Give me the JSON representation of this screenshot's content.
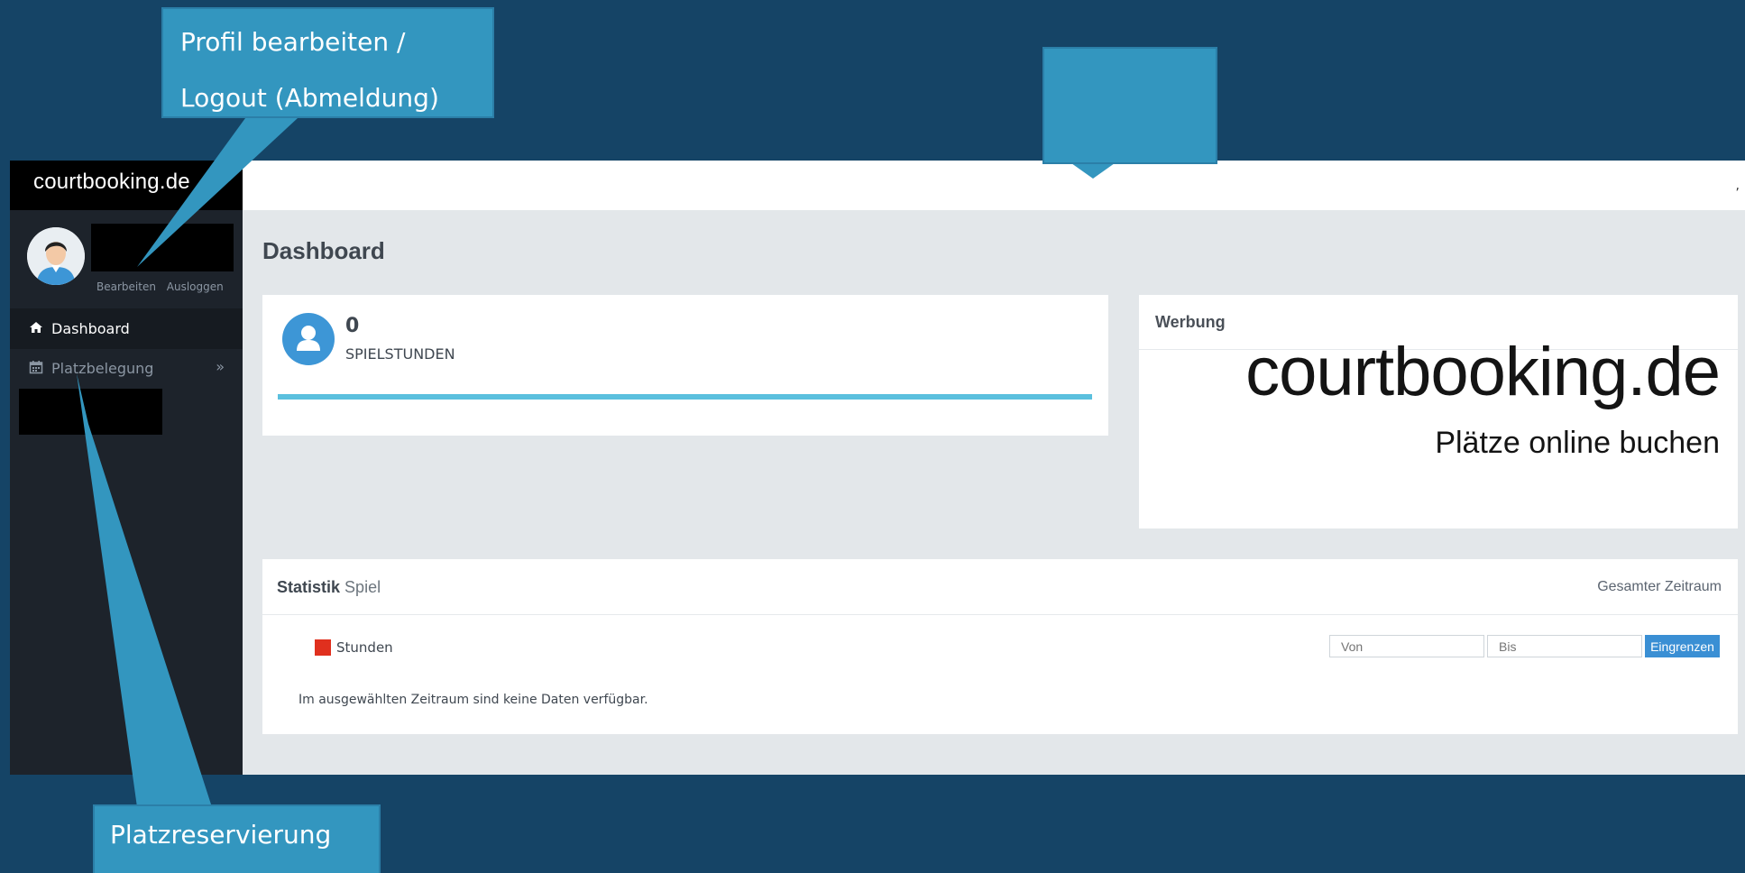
{
  "app": {
    "brand": "courtbooking.de",
    "profile_links": {
      "edit": "Bearbeiten",
      "logout": "Ausloggen"
    }
  },
  "sidebar": {
    "items": [
      {
        "label": "Dashboard",
        "icon": "home-icon",
        "active": true
      },
      {
        "label": "Platzbelegung",
        "icon": "calendar-icon",
        "expandable": true
      }
    ]
  },
  "main": {
    "title": "Dashboard",
    "stat": {
      "value": "0",
      "label": "SPIELSTUNDEN",
      "progress": 1.0
    },
    "ad": {
      "title": "Werbung",
      "logo_text": "courtbooking.de",
      "slogan": "Plätze online buchen"
    },
    "statistics": {
      "title": "Statistik",
      "subtitle": "Spiel",
      "range": "Gesamter Zeitraum",
      "legend": [
        {
          "label": "Stunden",
          "color": "#e0301e"
        }
      ],
      "from_placeholder": "Von",
      "to_placeholder": "Bis",
      "filter_button": "Eingrenzen",
      "empty_message": "Im ausgewählten Zeitraum sind keine Daten verfügbar."
    }
  },
  "callouts": {
    "profile_line1": "Profil bearbeiten /",
    "profile_line2": "Logout (Abmeldung)",
    "reservation": "Platzreservierung"
  },
  "colors": {
    "background": "#154466",
    "callout": "#3396bf",
    "sidebar": "#1d232b",
    "accent": "#3a8fd4"
  }
}
